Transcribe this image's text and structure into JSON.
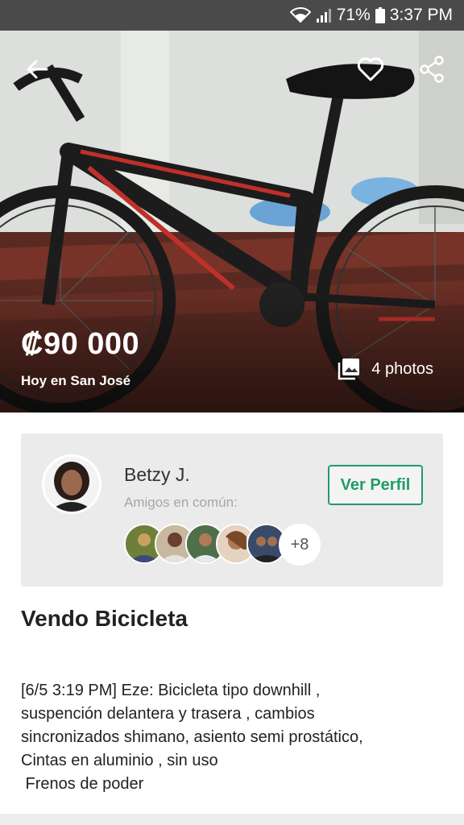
{
  "status_bar": {
    "battery_percent": "71%",
    "time": "3:37 PM",
    "icons": [
      "wifi-icon",
      "signal-icon",
      "battery-icon"
    ]
  },
  "listing": {
    "price": "₡90 000",
    "location": "Hoy en San José",
    "photos_label": "4 photos",
    "title": "Vendo Bicicleta",
    "description_lines": [
      "[6/5 3:19 PM] Eze: Bicicleta tipo downhill ,",
      "suspención delantera y trasera , cambios",
      "sincronizados shimano, asiento semi prostático,",
      "Cintas en aluminio , sin uso",
      " Frenos de poder"
    ]
  },
  "seller": {
    "name": "Betzy J.",
    "mutual_label": "Amigos en común:",
    "profile_button": "Ver Perfil",
    "mutual_more": "+8"
  },
  "colors": {
    "accent": "#1f9d68",
    "status_bar": "#4a4a4a",
    "card_bg": "#ebebeb"
  }
}
